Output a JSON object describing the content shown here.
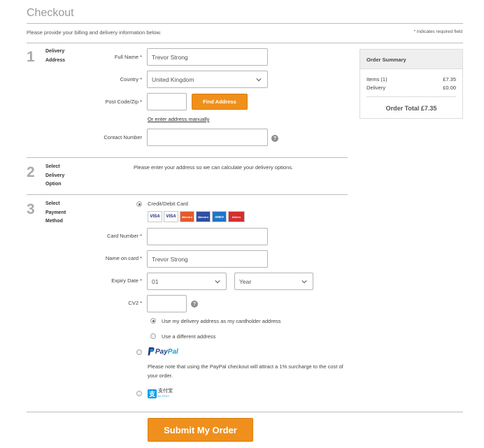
{
  "page": {
    "title": "Checkout",
    "intro": "Please provide your billing and delivery information below.",
    "required_note": "* indicates required field"
  },
  "step1": {
    "number": "1",
    "label_line1": "Delivery",
    "label_line2": "Address",
    "full_name_label": "Full Name *",
    "full_name_value": "Trevor Strong",
    "country_label": "Country *",
    "country_value": "United Kingdom",
    "postcode_label": "Post Code/Zip *",
    "postcode_value": "",
    "find_address_button": "Find Address",
    "manual_link": "Or enter address manually",
    "contact_label": "Contact Number",
    "contact_value": ""
  },
  "step2": {
    "number": "2",
    "label_line1": "Select",
    "label_line2": "Delivery",
    "label_line3": "Option",
    "message": "Please enter your address so we can calculate your delivery options."
  },
  "step3": {
    "number": "3",
    "label_line1": "Select",
    "label_line2": "Payment",
    "label_line3": "Method",
    "card_option_label": "Credit/Debit Card",
    "card_logos": [
      "VISA",
      "VISA",
      "Maestro",
      "Maestro",
      "AMEX",
      "Diners"
    ],
    "card_number_label": "Card Number *",
    "card_number_value": "",
    "name_on_card_label": "Name on card *",
    "name_on_card_value": "Trevor Strong",
    "expiry_label": "Expiry Date *",
    "expiry_month_value": "01",
    "expiry_year_value": "Year",
    "cv2_label": "CV2 *",
    "cv2_value": "",
    "use_delivery_address": "Use my delivery address as my cardholder address",
    "use_different_address": "Use a different address",
    "paypal_logo_text_1": "Pay",
    "paypal_logo_text_2": "Pal",
    "paypal_note": "Please note that using the PayPal checkout will attract a 1% surcharge to the cost of your order.",
    "alipay_logo_text": "支付宝",
    "alipay_logo_subtext": "ALIPAY"
  },
  "summary": {
    "heading": "Order Summary",
    "items_label": "Items (1)",
    "items_value": "£7.35",
    "delivery_label": "Delivery",
    "delivery_value": "£0.00",
    "total": "Order Total £7.35"
  },
  "submit_button": "Submit My Order",
  "colors": {
    "accent": "#ef901d",
    "paypal_dark": "#253b80",
    "paypal_light": "#179bd7",
    "alipay": "#00a0e9"
  },
  "icons": [
    "help-icon",
    "chevron-down-icon",
    "radio-icon",
    "paypal-logo-icon",
    "alipay-logo-icon"
  ]
}
